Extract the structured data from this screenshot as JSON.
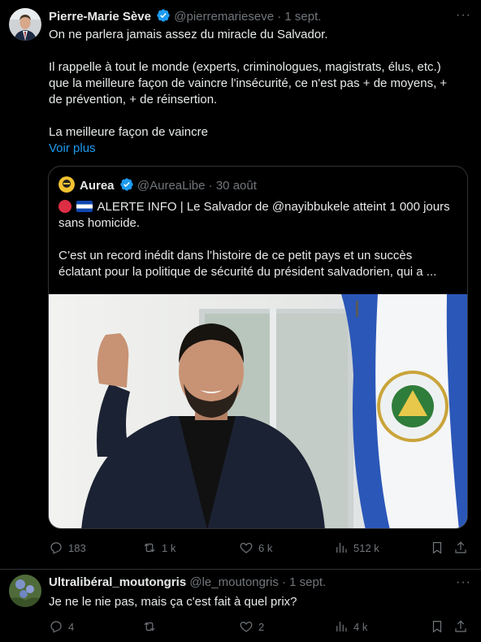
{
  "tweet1": {
    "author": "Pierre-Marie Sève",
    "handle": "@pierremarieseve",
    "dot": "·",
    "date": "1 sept.",
    "more": "···",
    "text_l1": "On ne parlera jamais assez du miracle du Salvador.",
    "text_l2": "Il rappelle à tout le monde (experts, criminologues, magistrats, élus, etc.)",
    "text_l3": "que la meilleure façon de vaincre l'insécurité, ce n'est pas + de moyens, +",
    "text_l4": "de prévention, + de réinsertion.",
    "text_l5": "La meilleure façon de vaincre",
    "show_more": "Voir plus",
    "quote": {
      "author": "Aurea",
      "handle": "@AureaLibe",
      "dot": "·",
      "date": "30 août",
      "l1": "ALERTE INFO | Le Salvador de @nayibbukele atteint 1 000 jours",
      "l2": "sans homicide.",
      "l3": "C’est un record inédit dans l’histoire de ce petit pays et un succès",
      "l4": "éclatant pour la politique de sécurité du président salvadorien, qui a ..."
    },
    "stats": {
      "replies": "183",
      "reposts": "1 k",
      "likes": "6 k",
      "views": "512 k"
    }
  },
  "tweet2": {
    "author": "Ultralibéral_moutongris",
    "handle": "@le_moutongris",
    "dot": "·",
    "date": "1 sept.",
    "more": "···",
    "text": "Je ne le nie pas, mais ça c'est fait à quel prix?",
    "stats": {
      "replies": "4",
      "reposts": "",
      "likes": "2",
      "views": "4 k"
    }
  },
  "colors": {
    "background": "#000000",
    "text": "#e7e9ea",
    "muted": "#71767b",
    "link": "#1d9bf0",
    "verified": "#1d9bf0"
  }
}
